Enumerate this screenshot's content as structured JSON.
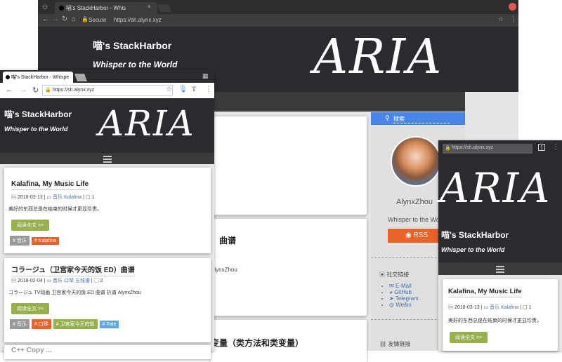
{
  "desktop": {
    "tab_title": "喵's StackHarbor - Whis",
    "secure_label": "Secure",
    "url": "https://sh.alynx.xyz",
    "site_title": "喵's StackHarbor",
    "site_subtitle": "Whisper to the World",
    "logo": "ARIA",
    "search_placeholder": "搜索",
    "author_name": "AlynxZhou",
    "author_motto": "Whisper to the World",
    "rss_label": "RSS",
    "social_heading": "社交链接",
    "social_links": [
      "E-Mail",
      "GitHub",
      "Telegram",
      "Weibo"
    ],
    "friends_heading": "友情链接",
    "partial_post_title_1": "）曲谱",
    "partial_post_author": "AlynxZhou",
    "partial_post_title_2": "变量（类方法和类变量）"
  },
  "phone": {
    "tab_title": "喵's StackHarbor - Whispe",
    "url": "https://sh.alynx.xyz",
    "site_title": "喵's StackHarbor",
    "site_subtitle": "Whisper to the World",
    "logo": "ARIA",
    "posts": [
      {
        "title": "Kalafina, My Music Life",
        "date": "2018-03-13",
        "category": "音乐",
        "tags_meta": "Kalafina",
        "comments": "1",
        "excerpt": "美好的东西总是在结束的时候才更显珍贵。",
        "readmore": "阅读全文 >>",
        "tags": [
          {
            "label": "# 音乐",
            "color": "#999999"
          },
          {
            "label": "# Kalafina",
            "color": "#e8622a"
          }
        ]
      },
      {
        "title": "コラージュ（卫宫家今天的饭 ED）曲谱",
        "date": "2018-02-04",
        "category": "音乐",
        "tags_meta": "口琴 五线谱",
        "comments": "2",
        "excerpt": "コラージュ TV动画 卫宫家今天的饭 ED 曲谱 扒谱 AlynxZhou",
        "readmore": "阅读全文 >>",
        "tags": [
          {
            "label": "# 音乐",
            "color": "#999999"
          },
          {
            "label": "# 口琴",
            "color": "#e8622a"
          },
          {
            "label": "# 卫宫家今天的饭",
            "color": "#96b04c"
          },
          {
            "label": "# Fate",
            "color": "#5aa9e6"
          }
        ]
      }
    ],
    "partial_post_title": "C++ Copy ..."
  },
  "tablet": {
    "url": "https://sh.alynx.xyz",
    "site_title": "喵's StackHarbor",
    "site_subtitle": "Whisper to the World",
    "logo": "ARIA",
    "post": {
      "title": "Kalafina, My Music Life",
      "date": "2018-03-13",
      "category": "音乐",
      "tags_meta": "Kalafina",
      "comments": "1",
      "excerpt": "美好的东西总是在结束的时候才更显珍贵。",
      "readmore": "阅读全文 >>"
    }
  },
  "colors": {
    "header_dark": "#2b2b2f",
    "search_blue": "#4a86e8",
    "rss_orange": "#e8622a",
    "readmore_green": "#96b04c",
    "tab_close_red": "#e05555"
  }
}
